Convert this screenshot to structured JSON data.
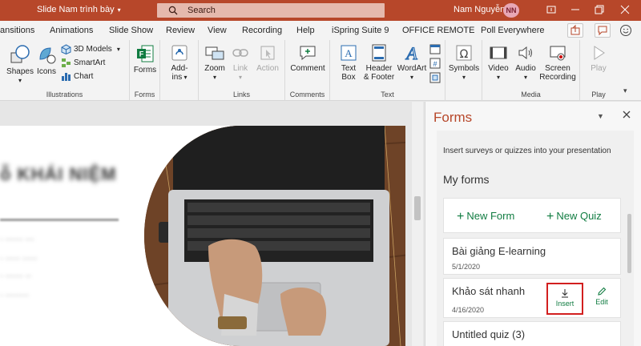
{
  "titlebar": {
    "doc_title": "Slide Nam trình bày",
    "search_placeholder": "Search",
    "user_name": "Nam Nguyễn",
    "user_initials": "NN",
    "accent": "#b7472a"
  },
  "tabs": [
    "ansitions",
    "Animations",
    "Slide Show",
    "Review",
    "View",
    "Recording",
    "Help",
    "iSpring Suite 9",
    "OFFICE REMOTE",
    "Poll Everywhere"
  ],
  "ribbon": {
    "illustrations": {
      "shapes": "Shapes",
      "icons": "Icons",
      "models": "3D Models",
      "smartart": "SmartArt",
      "chart": "Chart",
      "label": "Illustrations"
    },
    "forms": {
      "button": "Forms",
      "label": "Forms"
    },
    "addins": {
      "line1": "Add-",
      "line2": "ins"
    },
    "links": {
      "zoom": "Zoom",
      "link": "Link",
      "action": "Action",
      "label": "Links"
    },
    "comments": {
      "comment": "Comment",
      "label": "Comments"
    },
    "text": {
      "textbox_1": "Text",
      "textbox_2": "Box",
      "header_1": "Header",
      "header_2": "& Footer",
      "wordart": "WordArt",
      "label": "Text"
    },
    "symbols": {
      "button": "Symbols"
    },
    "media": {
      "video": "Video",
      "audio": "Audio",
      "screen_1": "Screen",
      "screen_2": "Recording",
      "label": "Media"
    },
    "play": {
      "button": "Play",
      "label": "Play"
    }
  },
  "forms_pane": {
    "title": "Forms",
    "description": "Insert surveys or quizzes into your presentation",
    "my_forms": "My forms",
    "new_form": "New Form",
    "new_quiz": "New Quiz",
    "items": [
      {
        "title": "Bài giảng E-learning",
        "date": "5/1/2020"
      },
      {
        "title": "Khảo sát nhanh",
        "date": "4/16/2020",
        "insert": "Insert",
        "edit": "Edit"
      },
      {
        "title": "Untitled quiz (3)"
      }
    ],
    "brand_green": "#107c41"
  }
}
